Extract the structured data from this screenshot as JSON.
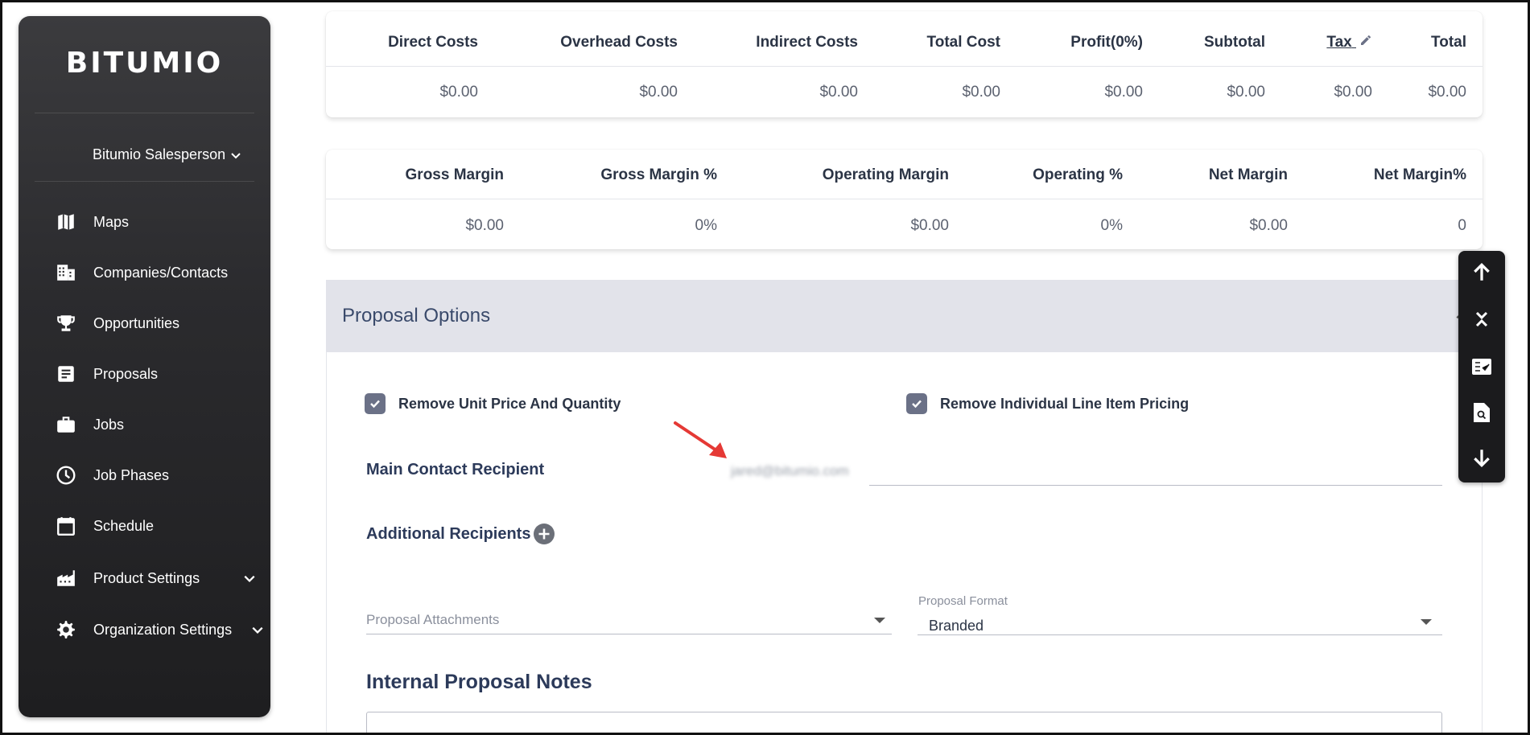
{
  "app": {
    "logo": "BITUMIO"
  },
  "user": {
    "name": "Bitumio Salesperson"
  },
  "sidebar": {
    "items": [
      {
        "label": "Maps",
        "icon": "map-icon"
      },
      {
        "label": "Companies/Contacts",
        "icon": "building-icon"
      },
      {
        "label": "Opportunities",
        "icon": "trophy-icon"
      },
      {
        "label": "Proposals",
        "icon": "document-icon"
      },
      {
        "label": "Jobs",
        "icon": "briefcase-icon"
      },
      {
        "label": "Job Phases",
        "icon": "clock-icon"
      },
      {
        "label": "Schedule",
        "icon": "calendar-icon"
      },
      {
        "label": "Product Settings",
        "icon": "factory-icon"
      },
      {
        "label": "Organization Settings",
        "icon": "gear-icon"
      }
    ]
  },
  "costs": {
    "headers": [
      "Direct Costs",
      "Overhead Costs",
      "Indirect Costs",
      "Total Cost",
      "Profit(0%)",
      "Subtotal",
      "Tax",
      "Total"
    ],
    "values": [
      "$0.00",
      "$0.00",
      "$0.00",
      "$0.00",
      "$0.00",
      "$0.00",
      "$0.00",
      "$0.00"
    ]
  },
  "margins": {
    "headers": [
      "Gross Margin",
      "Gross Margin %",
      "Operating Margin",
      "Operating %",
      "Net Margin",
      "Net Margin%"
    ],
    "values": [
      "$0.00",
      "0%",
      "$0.00",
      "0%",
      "$0.00",
      "0"
    ]
  },
  "proposal_options": {
    "title": "Proposal Options",
    "remove_unit_price_label": "Remove Unit Price And Quantity",
    "remove_unit_price_checked": true,
    "remove_line_item_label": "Remove Individual Line Item Pricing",
    "remove_line_item_checked": true,
    "main_contact_label": "Main Contact Recipient",
    "main_contact_value": "jared@bitumio.com",
    "additional_recipients_label": "Additional Recipients",
    "attachments_placeholder": "Proposal Attachments",
    "format_label": "Proposal Format",
    "format_value": "Branded",
    "internal_notes_title": "Internal Proposal Notes"
  },
  "colors": {
    "sidebar_bg": "#2b2b2e",
    "section_header_bg": "#e2e3ea",
    "checkbox": "#6b7187",
    "annotation_arrow": "#e53935"
  }
}
